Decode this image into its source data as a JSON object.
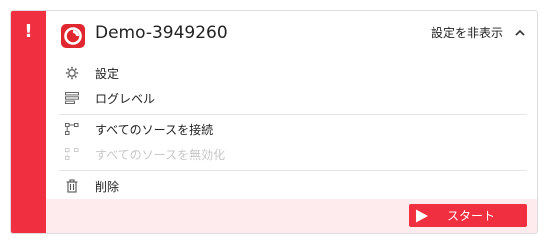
{
  "header": {
    "alert_symbol": "!",
    "app_title": "Demo-3949260",
    "hide_settings_label": "設定を非表示"
  },
  "menu": {
    "settings_label": "設定",
    "log_level_label": "ログレベル",
    "connect_all_label": "すべてのソースを接続",
    "disable_all_label": "すべてのソースを無効化",
    "delete_label": "削除"
  },
  "footer": {
    "start_label": "スタート"
  },
  "colors": {
    "accent": "#f02f41",
    "footer_bg": "#fdebed",
    "disabled_text": "#c8c8c8"
  },
  "icons": {
    "alert": "exclamation-icon",
    "logo": "app-logo-icon",
    "collapse": "chevron-up-icon",
    "settings": "gear-icon",
    "log_level": "list-lines-icon",
    "connect_all": "connect-sources-icon",
    "disable_all": "disable-sources-icon",
    "delete": "trash-icon",
    "start": "play-icon"
  }
}
